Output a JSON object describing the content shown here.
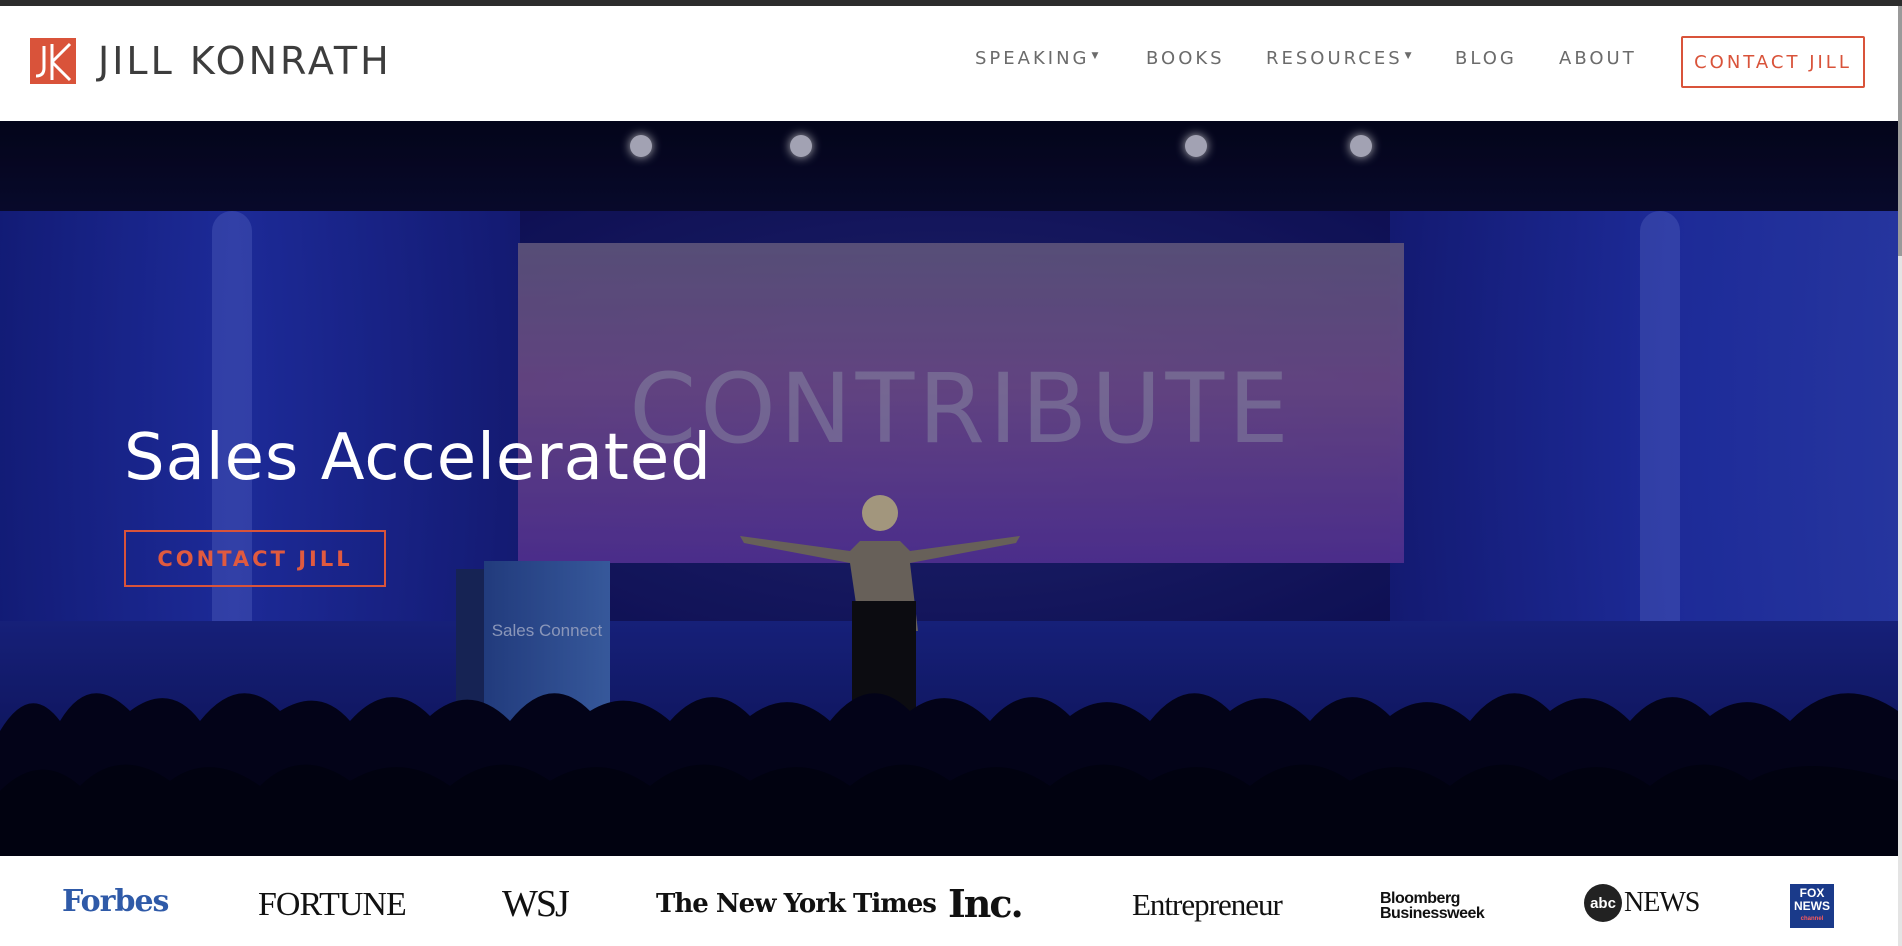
{
  "header": {
    "brand_name": "JILL KONRATH",
    "logo_icon": "jk-monogram-icon",
    "nav": [
      {
        "label": "SPEAKING",
        "has_dropdown": true
      },
      {
        "label": "BOOKS",
        "has_dropdown": false
      },
      {
        "label": "RESOURCES",
        "has_dropdown": true
      },
      {
        "label": "BLOG",
        "has_dropdown": false
      },
      {
        "label": "ABOUT",
        "has_dropdown": false
      }
    ],
    "cta_label": "CONTACT JILL"
  },
  "hero": {
    "title": "Sales Accelerated",
    "cta_label": "CONTACT JILL",
    "screen_text": "CONTRIBUTE",
    "podium_text": "Sales Connect"
  },
  "press": {
    "logos": [
      "Forbes",
      "FORTUNE",
      "WSJ",
      "The New York Times",
      "Inc.",
      "Entrepreneur",
      "Bloomberg Businessweek",
      "abc NEWS",
      "FOX NEWS channel"
    ],
    "abc_mark": "abc",
    "abc_word": "NEWS",
    "bloomberg_line1": "Bloomberg",
    "bloomberg_line2": "Businessweek",
    "fox_line1": "FOX",
    "fox_line2": "NEWS",
    "fox_line3": "channel"
  },
  "colors": {
    "accent": "#d9533a",
    "nav_text": "#6b6b6b",
    "forbes_blue": "#2f5aa8"
  }
}
